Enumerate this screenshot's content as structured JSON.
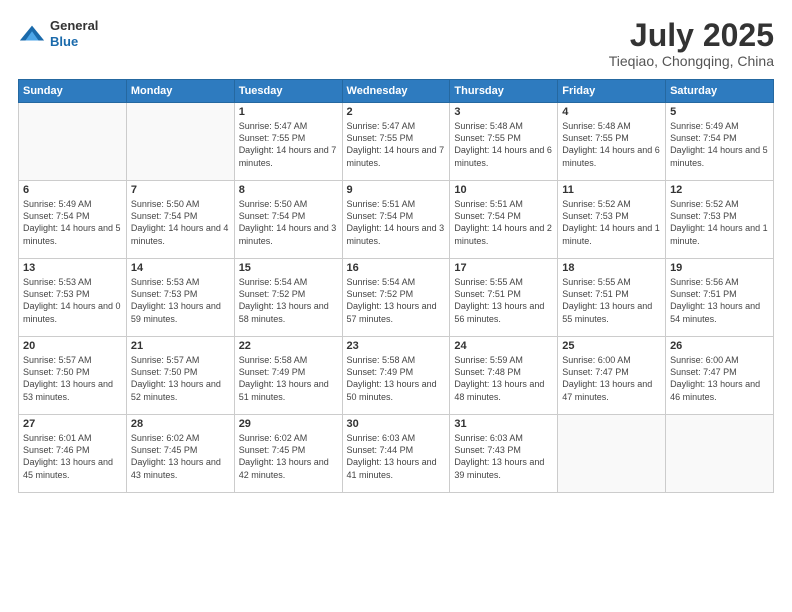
{
  "header": {
    "logo_general": "General",
    "logo_blue": "Blue",
    "main_title": "July 2025",
    "subtitle": "Tieqiao, Chongqing, China"
  },
  "weekdays": [
    "Sunday",
    "Monday",
    "Tuesday",
    "Wednesday",
    "Thursday",
    "Friday",
    "Saturday"
  ],
  "weeks": [
    [
      {
        "day": "",
        "sunrise": "",
        "sunset": "",
        "daylight": ""
      },
      {
        "day": "",
        "sunrise": "",
        "sunset": "",
        "daylight": ""
      },
      {
        "day": "1",
        "sunrise": "Sunrise: 5:47 AM",
        "sunset": "Sunset: 7:55 PM",
        "daylight": "Daylight: 14 hours and 7 minutes."
      },
      {
        "day": "2",
        "sunrise": "Sunrise: 5:47 AM",
        "sunset": "Sunset: 7:55 PM",
        "daylight": "Daylight: 14 hours and 7 minutes."
      },
      {
        "day": "3",
        "sunrise": "Sunrise: 5:48 AM",
        "sunset": "Sunset: 7:55 PM",
        "daylight": "Daylight: 14 hours and 6 minutes."
      },
      {
        "day": "4",
        "sunrise": "Sunrise: 5:48 AM",
        "sunset": "Sunset: 7:55 PM",
        "daylight": "Daylight: 14 hours and 6 minutes."
      },
      {
        "day": "5",
        "sunrise": "Sunrise: 5:49 AM",
        "sunset": "Sunset: 7:54 PM",
        "daylight": "Daylight: 14 hours and 5 minutes."
      }
    ],
    [
      {
        "day": "6",
        "sunrise": "Sunrise: 5:49 AM",
        "sunset": "Sunset: 7:54 PM",
        "daylight": "Daylight: 14 hours and 5 minutes."
      },
      {
        "day": "7",
        "sunrise": "Sunrise: 5:50 AM",
        "sunset": "Sunset: 7:54 PM",
        "daylight": "Daylight: 14 hours and 4 minutes."
      },
      {
        "day": "8",
        "sunrise": "Sunrise: 5:50 AM",
        "sunset": "Sunset: 7:54 PM",
        "daylight": "Daylight: 14 hours and 3 minutes."
      },
      {
        "day": "9",
        "sunrise": "Sunrise: 5:51 AM",
        "sunset": "Sunset: 7:54 PM",
        "daylight": "Daylight: 14 hours and 3 minutes."
      },
      {
        "day": "10",
        "sunrise": "Sunrise: 5:51 AM",
        "sunset": "Sunset: 7:54 PM",
        "daylight": "Daylight: 14 hours and 2 minutes."
      },
      {
        "day": "11",
        "sunrise": "Sunrise: 5:52 AM",
        "sunset": "Sunset: 7:53 PM",
        "daylight": "Daylight: 14 hours and 1 minute."
      },
      {
        "day": "12",
        "sunrise": "Sunrise: 5:52 AM",
        "sunset": "Sunset: 7:53 PM",
        "daylight": "Daylight: 14 hours and 1 minute."
      }
    ],
    [
      {
        "day": "13",
        "sunrise": "Sunrise: 5:53 AM",
        "sunset": "Sunset: 7:53 PM",
        "daylight": "Daylight: 14 hours and 0 minutes."
      },
      {
        "day": "14",
        "sunrise": "Sunrise: 5:53 AM",
        "sunset": "Sunset: 7:53 PM",
        "daylight": "Daylight: 13 hours and 59 minutes."
      },
      {
        "day": "15",
        "sunrise": "Sunrise: 5:54 AM",
        "sunset": "Sunset: 7:52 PM",
        "daylight": "Daylight: 13 hours and 58 minutes."
      },
      {
        "day": "16",
        "sunrise": "Sunrise: 5:54 AM",
        "sunset": "Sunset: 7:52 PM",
        "daylight": "Daylight: 13 hours and 57 minutes."
      },
      {
        "day": "17",
        "sunrise": "Sunrise: 5:55 AM",
        "sunset": "Sunset: 7:51 PM",
        "daylight": "Daylight: 13 hours and 56 minutes."
      },
      {
        "day": "18",
        "sunrise": "Sunrise: 5:55 AM",
        "sunset": "Sunset: 7:51 PM",
        "daylight": "Daylight: 13 hours and 55 minutes."
      },
      {
        "day": "19",
        "sunrise": "Sunrise: 5:56 AM",
        "sunset": "Sunset: 7:51 PM",
        "daylight": "Daylight: 13 hours and 54 minutes."
      }
    ],
    [
      {
        "day": "20",
        "sunrise": "Sunrise: 5:57 AM",
        "sunset": "Sunset: 7:50 PM",
        "daylight": "Daylight: 13 hours and 53 minutes."
      },
      {
        "day": "21",
        "sunrise": "Sunrise: 5:57 AM",
        "sunset": "Sunset: 7:50 PM",
        "daylight": "Daylight: 13 hours and 52 minutes."
      },
      {
        "day": "22",
        "sunrise": "Sunrise: 5:58 AM",
        "sunset": "Sunset: 7:49 PM",
        "daylight": "Daylight: 13 hours and 51 minutes."
      },
      {
        "day": "23",
        "sunrise": "Sunrise: 5:58 AM",
        "sunset": "Sunset: 7:49 PM",
        "daylight": "Daylight: 13 hours and 50 minutes."
      },
      {
        "day": "24",
        "sunrise": "Sunrise: 5:59 AM",
        "sunset": "Sunset: 7:48 PM",
        "daylight": "Daylight: 13 hours and 48 minutes."
      },
      {
        "day": "25",
        "sunrise": "Sunrise: 6:00 AM",
        "sunset": "Sunset: 7:47 PM",
        "daylight": "Daylight: 13 hours and 47 minutes."
      },
      {
        "day": "26",
        "sunrise": "Sunrise: 6:00 AM",
        "sunset": "Sunset: 7:47 PM",
        "daylight": "Daylight: 13 hours and 46 minutes."
      }
    ],
    [
      {
        "day": "27",
        "sunrise": "Sunrise: 6:01 AM",
        "sunset": "Sunset: 7:46 PM",
        "daylight": "Daylight: 13 hours and 45 minutes."
      },
      {
        "day": "28",
        "sunrise": "Sunrise: 6:02 AM",
        "sunset": "Sunset: 7:45 PM",
        "daylight": "Daylight: 13 hours and 43 minutes."
      },
      {
        "day": "29",
        "sunrise": "Sunrise: 6:02 AM",
        "sunset": "Sunset: 7:45 PM",
        "daylight": "Daylight: 13 hours and 42 minutes."
      },
      {
        "day": "30",
        "sunrise": "Sunrise: 6:03 AM",
        "sunset": "Sunset: 7:44 PM",
        "daylight": "Daylight: 13 hours and 41 minutes."
      },
      {
        "day": "31",
        "sunrise": "Sunrise: 6:03 AM",
        "sunset": "Sunset: 7:43 PM",
        "daylight": "Daylight: 13 hours and 39 minutes."
      },
      {
        "day": "",
        "sunrise": "",
        "sunset": "",
        "daylight": ""
      },
      {
        "day": "",
        "sunrise": "",
        "sunset": "",
        "daylight": ""
      }
    ]
  ]
}
